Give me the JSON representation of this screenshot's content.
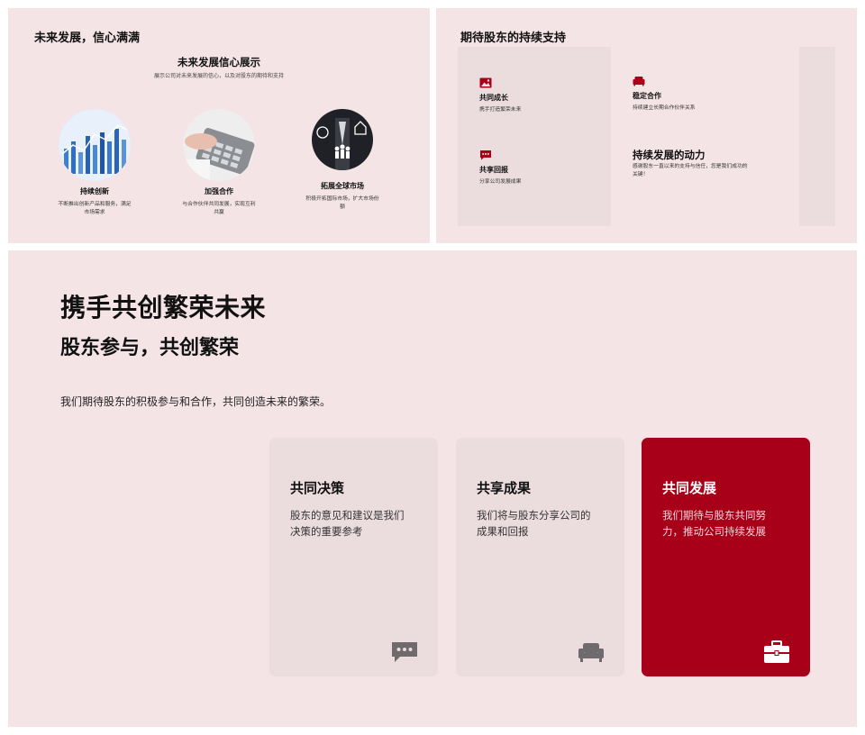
{
  "colors": {
    "panel_bg": "#f4e4e6",
    "card_bg": "#ebdcde",
    "accent": "#a70018",
    "icon_gray": "#6f6a6b"
  },
  "panel_a": {
    "title": "未来发展，信心满满",
    "heading": "未来发展信心展示",
    "subheading": "展示公司对未来发展的信心，以及对股东的期待和支持",
    "items": [
      {
        "image": "chart-photo",
        "title": "持续创新",
        "desc": "不断推出创新产品和服务，满足市场需求"
      },
      {
        "image": "calculator-photo",
        "title": "加强合作",
        "desc": "与合作伙伴共同发展，实现互利共赢"
      },
      {
        "image": "business-network-photo",
        "title": "拓展全球市场",
        "desc": "积极开拓国际市场，扩大市场份额"
      }
    ]
  },
  "panel_b": {
    "title": "期待股东的持续支持",
    "cells": [
      {
        "icon": "image-icon",
        "title": "共同成长",
        "desc": "携手打造繁荣未来"
      },
      {
        "icon": "sofa-icon",
        "title": "稳定合作",
        "desc": "持续建立长期合作伙伴关系"
      },
      {
        "icon": "chat-icon",
        "title": "共享回报",
        "desc": "分享公司发展成果"
      }
    ],
    "highlight": {
      "title": "持续发展的动力",
      "desc": "感谢股东一直以来的支持与信任，您是我们成功的关键！"
    }
  },
  "panel_c": {
    "title": "携手共创繁荣未来",
    "subtitle": "股东参与，共创繁荣",
    "desc": "我们期待股东的积极参与和合作，共同创造未来的繁荣。",
    "cards": [
      {
        "title": "共同决策",
        "desc": "股东的意见和建议是我们决策的重要参考",
        "icon": "chat-icon"
      },
      {
        "title": "共享成果",
        "desc": "我们将与股东分享公司的成果和回报",
        "icon": "sofa-icon"
      },
      {
        "title": "共同发展",
        "desc": "我们期待与股东共同努力，推动公司持续发展",
        "icon": "briefcase-icon"
      }
    ]
  }
}
